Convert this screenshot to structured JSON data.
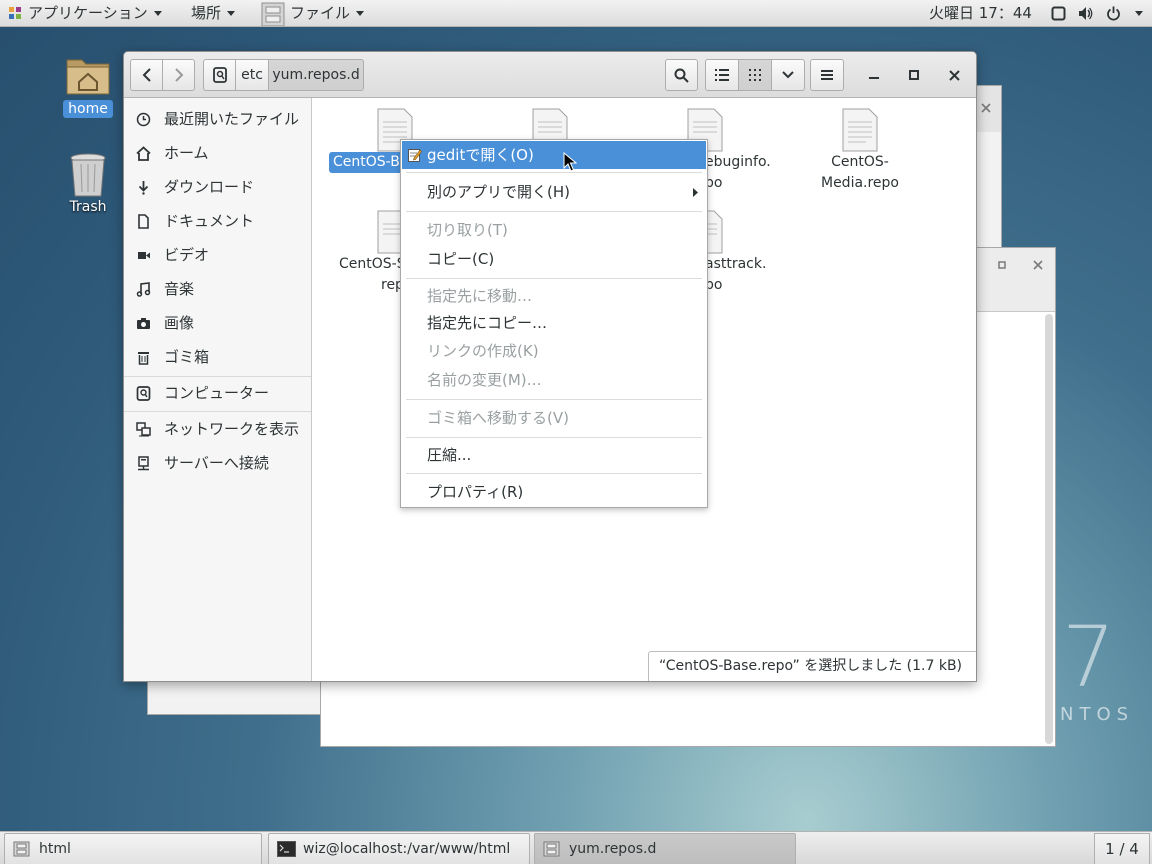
{
  "top_panel": {
    "applications": "アプリケーション",
    "places": "場所",
    "app_menu": "ファイル",
    "clock": "火曜日 17：44",
    "icons": [
      "screen-icon",
      "volume-icon",
      "power-icon"
    ]
  },
  "desktop": {
    "home_label": "home",
    "trash_label": "Trash",
    "logo_number": "7",
    "logo_text": "NTOS"
  },
  "window": {
    "path": [
      "etc",
      "yum.repos.d"
    ],
    "sidebar": [
      {
        "label": "最近開いたファイル",
        "icon": "clock-icon"
      },
      {
        "label": "ホーム",
        "icon": "home-icon"
      },
      {
        "label": "ダウンロード",
        "icon": "download-icon"
      },
      {
        "label": "ドキュメント",
        "icon": "document-icon"
      },
      {
        "label": "ビデオ",
        "icon": "video-icon"
      },
      {
        "label": "音楽",
        "icon": "music-icon"
      },
      {
        "label": "画像",
        "icon": "camera-icon"
      },
      {
        "label": "ゴミ箱",
        "icon": "trash-icon"
      },
      {
        "label": "コンピューター",
        "icon": "computer-icon"
      },
      {
        "label": "ネットワークを表示",
        "icon": "network-icon"
      },
      {
        "label": "サーバーへ接続",
        "icon": "server-icon"
      }
    ],
    "files": [
      {
        "name": "CentOS-B",
        "line2": ""
      },
      {
        "name": "",
        "line2": ""
      },
      {
        "name": "ebuginfo.",
        "line2": "po"
      },
      {
        "name": "CentOS-Media.repo",
        "line2": ""
      },
      {
        "name": "CentOS-S",
        "line2": "rep"
      },
      {
        "name": "asttrack.",
        "line2": "po"
      }
    ],
    "status": "“CentOS-Base.repo” を選択しました (1.7 kB)"
  },
  "context_menu": {
    "items": [
      {
        "label": "geditで開く(O)",
        "state": "highlighted"
      },
      {
        "label": "別のアプリで開く(H)",
        "state": "enabled"
      },
      {
        "label": "切り取り(T)",
        "state": "disabled"
      },
      {
        "label": "コピー(C)",
        "state": "enabled"
      },
      {
        "label": "指定先に移動…",
        "state": "disabled"
      },
      {
        "label": "指定先にコピー…",
        "state": "enabled"
      },
      {
        "label": "リンクの作成(K)",
        "state": "disabled"
      },
      {
        "label": "名前の変更(M)…",
        "state": "disabled"
      },
      {
        "label": "ゴミ箱へ移動する(V)",
        "state": "disabled"
      },
      {
        "label": "圧縮...",
        "state": "enabled"
      },
      {
        "label": "プロパティ(R)",
        "state": "enabled"
      }
    ]
  },
  "taskbar": {
    "tasks": [
      "html",
      "wiz@localhost:/var/www/html",
      "yum.repos.d"
    ],
    "workspace": "1 / 4"
  },
  "colors": {
    "accent": "#4a90d9",
    "panel": "#e6e6e6",
    "disabled_text": "#9aa0a2"
  }
}
